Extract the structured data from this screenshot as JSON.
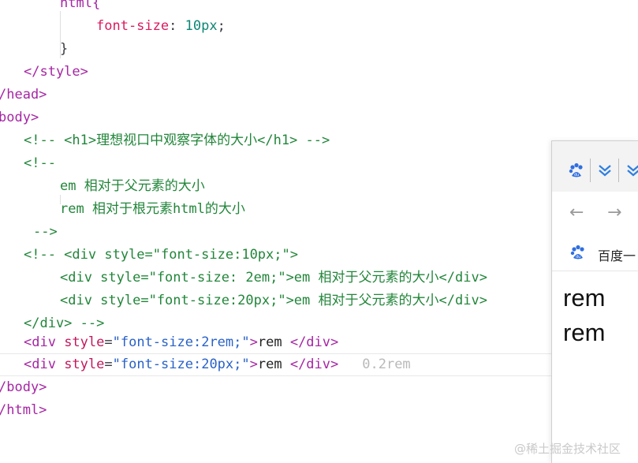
{
  "editor": {
    "lines": {
      "l0": {
        "a": "html{"
      },
      "l1": {
        "prop": "font-size",
        "colon": ": ",
        "num": "10px",
        "semi": ";"
      },
      "l2": {
        "a": "}"
      },
      "l3": {
        "a": "</style>"
      },
      "l4": {
        "a": "/head>"
      },
      "l5": {
        "a": "body>"
      },
      "l6": {
        "a": "<!-- <h1>理想视口中观察字体的大小</h1> -->"
      },
      "l7": {
        "a": "<!--"
      },
      "l8": {
        "a": "em 相对于父元素的大小"
      },
      "l9": {
        "a": "rem 相对于根元素html的大小"
      },
      "l10": {
        "a": "-->"
      },
      "l11": {
        "a": "<!-- <div style=\"font-size:10px;\">"
      },
      "l12": {
        "a": "<div style=\"font-size: 2em;\">em 相对于父元素的大小</div>"
      },
      "l13": {
        "a": "<div style=\"font-size:20px;\">em 相对于父元素的大小</div>"
      },
      "l14": {
        "a": "</div> -->"
      },
      "l15": {
        "open": "<div ",
        "attr": "style",
        "eq": "=",
        "str": "\"font-size:2rem;\"",
        "close": ">",
        "text": "rem ",
        "end": "</div>"
      },
      "l16": {
        "open": "<div ",
        "attr": "style",
        "eq": "=",
        "str": "\"font-size:20px;\"",
        "close": ">",
        "text": "rem ",
        "end": "</div>",
        "hint": "0.2rem"
      },
      "l17": {
        "a": "/body>"
      },
      "l18": {
        "a": "/html>"
      }
    }
  },
  "browser": {
    "bookmark_label": "百度一",
    "nav": {
      "back": "←",
      "forward": "→"
    },
    "content": [
      "rem",
      "rem"
    ]
  },
  "watermark": "@稀土掘金技术社区",
  "colors": {
    "tag": "#a626a4",
    "attr": "#c2185b",
    "string": "#2962c8",
    "number": "#0d8574",
    "comment": "#22863a",
    "baidu_blue": "#2f6fe0"
  }
}
